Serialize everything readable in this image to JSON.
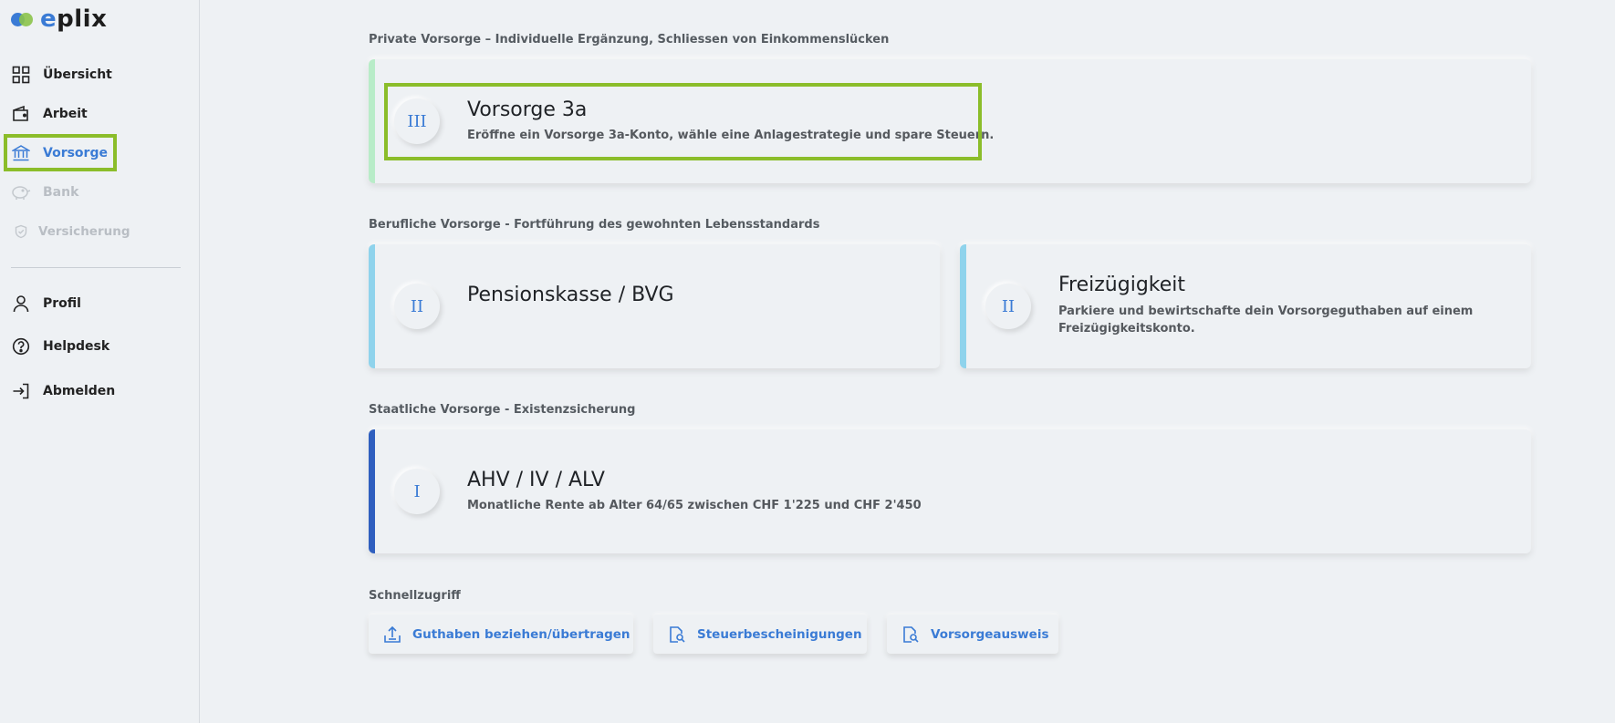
{
  "brand": {
    "logo_text_e": "e",
    "logo_text_rest": "plix",
    "colors": {
      "blue": "#3a7bd5",
      "green": "#8bc34a"
    }
  },
  "sidebar": {
    "items": [
      {
        "label": "Übersicht",
        "icon": "grid-icon"
      },
      {
        "label": "Arbeit",
        "icon": "wallet-icon"
      },
      {
        "label": "Vorsorge",
        "icon": "bank-icon",
        "active": true
      },
      {
        "label": "Bank",
        "icon": "piggy-bank-icon",
        "disabled": true
      },
      {
        "label": "Versicherung",
        "icon": "shield-icon",
        "disabled": true
      },
      {
        "label": "Profil",
        "icon": "user-icon"
      },
      {
        "label": "Helpdesk",
        "icon": "help-circle-icon"
      },
      {
        "label": "Abmelden",
        "icon": "logout-icon"
      }
    ]
  },
  "sections": {
    "private": "Private Vorsorge – Individuelle Ergänzung, Schliessen von Einkommenslücken",
    "occupational": "Berufliche Vorsorge - Fortführung des gewohnten Lebensstandards",
    "state": "Staatliche Vorsorge - Existenzsicherung",
    "quick": "Schnellzugriff"
  },
  "cards": {
    "pillar3a": {
      "numeral": "III",
      "title": "Vorsorge 3a",
      "desc": "Eröffne ein Vorsorge 3a-Konto, wähle eine Anlagestrategie und spare Steuern.",
      "accent": "#b8ecc8"
    },
    "bvg": {
      "numeral": "II",
      "title": "Pensionskasse / BVG",
      "accent": "#8fd3ec"
    },
    "free": {
      "numeral": "II",
      "title": "Freizügigkeit",
      "desc_line1": "Parkiere und bewirtschafte dein Vorsorgeguthaben auf einem",
      "desc_line2": "Freizügigkeitskonto.",
      "accent": "#8fd3ec"
    },
    "ahv": {
      "numeral": "I",
      "title": "AHV / IV / ALV",
      "desc": "Monatliche Rente ab Alter 64/65 zwischen CHF 1'225 und CHF 2'450",
      "accent": "#2f5fbf"
    }
  },
  "quick": {
    "withdraw": "Guthaben beziehen/übertragen",
    "tax": "Steuerbescheinigungen",
    "cert": "Vorsorgeausweis"
  }
}
